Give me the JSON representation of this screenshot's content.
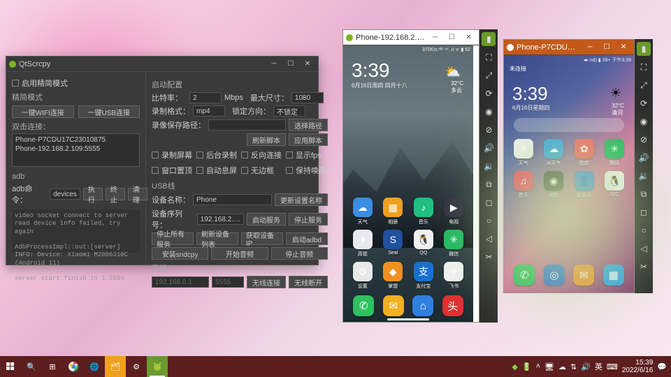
{
  "taskbar": {
    "time": "15:39",
    "date": "2022/6/16",
    "ime": "英",
    "icons": [
      "start",
      "search",
      "taskview",
      "chrome",
      "edge",
      "explorer",
      "settings",
      "android"
    ]
  },
  "qt": {
    "title": "QtScrcpy",
    "simple_mode_chk": "启用精简模式",
    "simple_mode": "精简模式",
    "btn_wifi": "一键WIFI连接",
    "btn_usb": "一键USB连接",
    "double_click": "双击连接：",
    "devices": [
      "Phone-P7CDU17C23010875",
      "Phone-192.168.2.109:5555"
    ],
    "adb_section": "adb",
    "adb_cmd_label": "adb命令：",
    "adb_cmd_value": "devices",
    "btn_exec": "执行",
    "btn_stop": "终止",
    "btn_clear": "清理",
    "log": "video socket connect to server read device info failed, try again\n\nAdbProcessImpl::out:[server] INFO: Device: Xiaomi M2006J10C (Android 11)\n\nserver start finish in 1.208s",
    "cfg_title": "启动配置",
    "bitrate_label": "比特率：",
    "bitrate_value": "2",
    "bitrate_unit": "Mbps",
    "maxsize_label": "最大尺寸：",
    "maxsize_value": "1080",
    "recfmt_label": "录制格式：",
    "recfmt_value": "mp4",
    "lockdir_label": "锁定方向：",
    "lockdir_value": "不锁定",
    "recpath_label": "录像保存路径：",
    "btn_choose_path": "选择路径",
    "btn_refresh": "刷新脚本",
    "btn_apply": "应用脚本",
    "chk1": "录制屏幕",
    "chk2": "后台录制",
    "chk3": "反向连接",
    "chk4": "显示fps",
    "chk5": "窗口置顶",
    "chk6": "自动息屏",
    "chk7": "无边框",
    "chk8": "保持唤醒",
    "usb_title": "USB线",
    "devname_label": "设备名称：",
    "devname_value": "Phone",
    "btn_update_name": "更新设置名称",
    "serial_label": "设备序列号：",
    "serial_value": "192.168.2.…",
    "btn_start_srv": "启动服务",
    "btn_stop_srv": "停止服务",
    "btn_stop_all": "停止所有服务",
    "btn_refresh_dev": "刷新设备列表",
    "btn_get_ip": "获取设备IP",
    "btn_start_adbd": "启动adbd",
    "btn_install_sndcpy": "安装sndcpy",
    "btn_start_audio": "开始音频",
    "btn_stop_audio": "停止音频",
    "wireless_title": "无线",
    "wl_ip": "192.168.0.1",
    "wl_port": "5555",
    "btn_wl_connect": "无线连接",
    "btn_wl_disconnect": "无线断开"
  },
  "phone1": {
    "title": "Phone-192.168.2.…",
    "status": "370K/s ᴴᴰ ⁴⁶ .ıl ᯤ ▮ 62",
    "clock": "3:39",
    "date": "6月16日周四 四月十八",
    "temp": "32°C",
    "weather_lbl": "多云",
    "apps": [
      {
        "n": "天气",
        "c": "#3a8de0",
        "g": "☁"
      },
      {
        "n": "相册",
        "c": "#f0a020",
        "g": "▦"
      },
      {
        "n": "音乐",
        "c": "#20c080",
        "g": "♪"
      },
      {
        "n": "电视",
        "c": "#303040",
        "g": "▶"
      },
      {
        "n": "高德",
        "c": "#e8e8f0",
        "g": "✈"
      },
      {
        "n": "Seal",
        "c": "#2050a0",
        "g": "S"
      },
      {
        "n": "QQ",
        "c": "#f0f0f0",
        "g": "🐧"
      },
      {
        "n": "微信",
        "c": "#20b860",
        "g": "✳"
      },
      {
        "n": "设置",
        "c": "#e8e8e8",
        "g": "⚙"
      },
      {
        "n": "掌盟",
        "c": "#f09020",
        "g": "◆"
      },
      {
        "n": "支付宝",
        "c": "#1870d0",
        "g": "支"
      },
      {
        "n": "飞书",
        "c": "#f0f0f0",
        "g": "✈"
      }
    ],
    "dock": [
      {
        "c": "#30c060",
        "g": "✆"
      },
      {
        "c": "#f0b020",
        "g": "✉"
      },
      {
        "c": "#3080e0",
        "g": "⌂"
      },
      {
        "c": "#e03030",
        "g": "头"
      }
    ]
  },
  "phone2": {
    "title": "Phone-P7CDU…",
    "status": "◂▸ nd) ▮ 28+ 下午3:39",
    "top_label": "未连接",
    "clock": "3:39",
    "date": "6月16日星期四",
    "temp": "32°C",
    "temp_sub": "清河",
    "apps": [
      {
        "n": "天气",
        "c": "#f0f0f0",
        "g": "☀"
      },
      {
        "n": "AI天气",
        "c": "#30a0e0",
        "g": "☁"
      },
      {
        "n": "图库",
        "c": "#f06060",
        "g": "✿"
      },
      {
        "n": "腾讯",
        "c": "#20b860",
        "g": "✳"
      },
      {
        "n": "音乐",
        "c": "#f04060",
        "g": "♫"
      },
      {
        "n": "相机",
        "c": "#404040",
        "g": "◉"
      },
      {
        "n": "联系人",
        "c": "#4080e0",
        "g": "👤"
      },
      {
        "n": "QQ",
        "c": "#f0f0f0",
        "g": "🐧"
      }
    ],
    "dock": [
      {
        "c": "#30c060",
        "g": "✆"
      },
      {
        "c": "#3070d0",
        "g": "◎"
      },
      {
        "c": "#f09030",
        "g": "✉"
      },
      {
        "c": "#30a0e0",
        "g": "▦"
      }
    ]
  },
  "sidebar_tips": [
    "fullscreen",
    "expand",
    "rotate",
    "eye",
    "no-eye",
    "vol-up",
    "vol-down",
    "copy",
    "square",
    "circle",
    "back",
    "scissors"
  ]
}
